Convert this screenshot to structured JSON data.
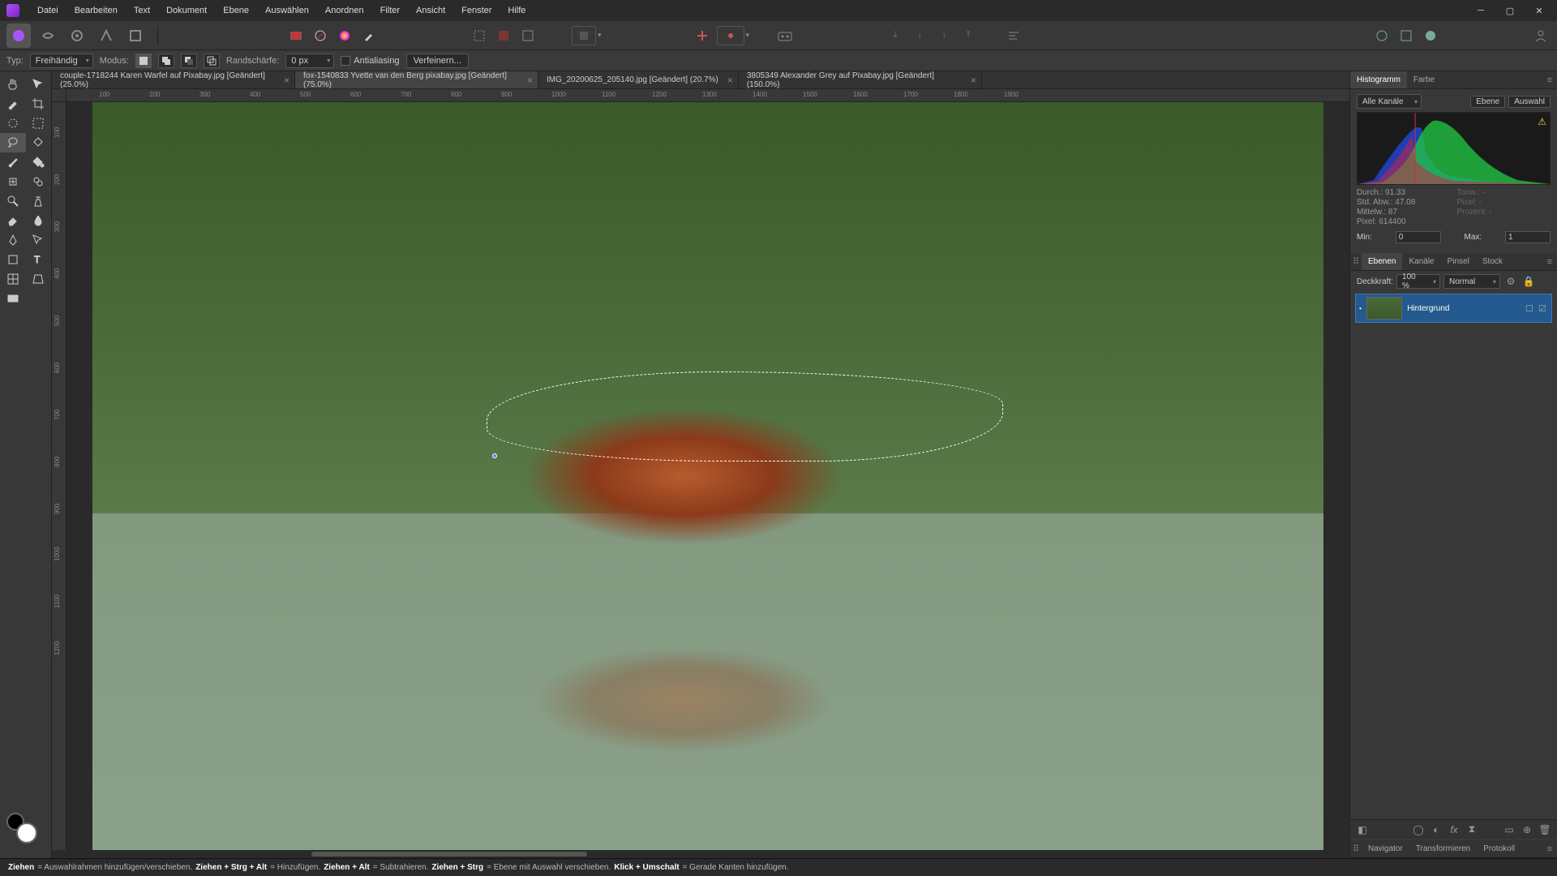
{
  "menu": [
    "Datei",
    "Bearbeiten",
    "Text",
    "Dokument",
    "Ebene",
    "Auswählen",
    "Anordnen",
    "Filter",
    "Ansicht",
    "Fenster",
    "Hilfe"
  ],
  "context": {
    "typ_label": "Typ:",
    "typ_value": "Freihändig",
    "modus_label": "Modus:",
    "feather_label": "Randschärfe:",
    "feather_value": "0 px",
    "antialiasing": "Antialiasing",
    "refine": "Verfeinern..."
  },
  "tabs": [
    {
      "title": "couple-1718244 Karen Warfel auf Pixabay.jpg [Geändert] (25.0%)",
      "active": false
    },
    {
      "title": "fox-1540833 Yvette van den Berg pixabay.jpg [Geändert] (75.0%)",
      "active": true
    },
    {
      "title": "IMG_20200625_205140.jpg [Geändert] (20.7%)",
      "active": false
    },
    {
      "title": "3805349 Alexander Grey auf Pixabay.jpg [Geändert] (150.0%)",
      "active": false
    }
  ],
  "ruler_h": [
    "100",
    "200",
    "300",
    "400",
    "500",
    "600",
    "700",
    "800",
    "900",
    "1000",
    "1100",
    "1200",
    "1300",
    "1400",
    "1500",
    "1600",
    "1700",
    "1800",
    "1900"
  ],
  "ruler_v": [
    "100",
    "200",
    "300",
    "400",
    "500",
    "600",
    "700",
    "800",
    "900",
    "1000",
    "1100",
    "1200"
  ],
  "histogram": {
    "tab_histo": "Histogramm",
    "tab_color": "Farbe",
    "channel": "Alle Kanäle",
    "layer_btn": "Ebene",
    "sel_btn": "Auswahl",
    "stats": {
      "durch": "Durch.: 91.33",
      "stdabw": "Std. Abw.: 47.08",
      "mittelw": "Mittelw.: 87",
      "pixel": "Pixel: 614400",
      "tonw": "Tonw.: -",
      "pixel2": "Pixel: -",
      "prozent": "Prozent: -"
    },
    "min_label": "Min:",
    "min_val": "0",
    "max_label": "Max:",
    "max_val": "1"
  },
  "layers_panel": {
    "tabs": [
      "Ebenen",
      "Kanäle",
      "Pinsel",
      "Stock"
    ],
    "opacity_label": "Deckkraft:",
    "opacity_val": "100 %",
    "blend": "Normal",
    "layer_name": "Hintergrund"
  },
  "bottom_tabs": [
    "Navigator",
    "Transformieren",
    "Protokoll"
  ],
  "statusbar": {
    "s1": "Ziehen",
    "t1": " = Auswahlrahmen hinzufügen/verschieben. ",
    "s2": "Ziehen + Strg + Alt",
    "t2": " = Hinzufügen. ",
    "s3": "Ziehen + Alt",
    "t3": " = Subtrahieren. ",
    "s4": "Ziehen + Strg",
    "t4": " = Ebene mit Auswahl verschieben. ",
    "s5": "Klick + Umschalt",
    "t5": " = Gerade Kanten hinzufügen."
  }
}
